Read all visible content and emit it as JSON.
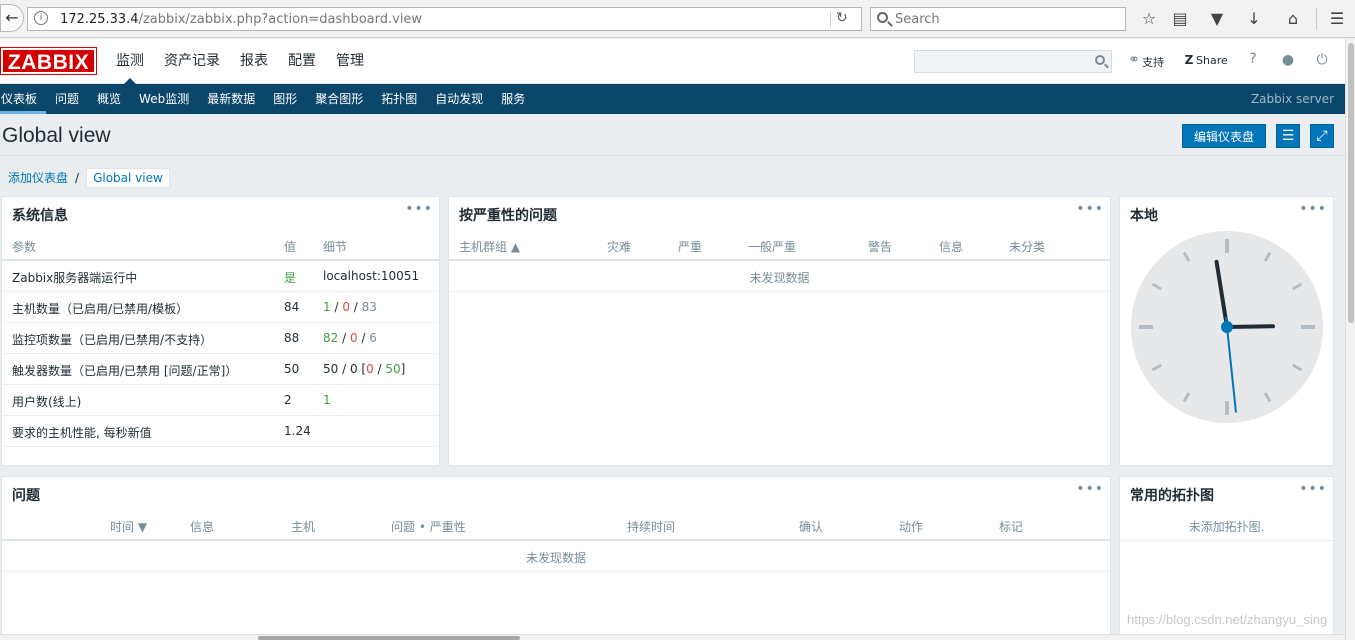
{
  "browser": {
    "url_host": "172.25.33.4",
    "url_path": "/zabbix/zabbix.php?action=dashboard.view",
    "search_placeholder": "Search"
  },
  "header": {
    "logo": "ZABBIX",
    "nav": [
      "监测",
      "资产记录",
      "报表",
      "配置",
      "管理"
    ],
    "support": "支持",
    "share": "Share",
    "help": "?"
  },
  "subnav": {
    "items": [
      "仪表板",
      "问题",
      "概览",
      "Web监测",
      "最新数据",
      "图形",
      "聚合图形",
      "拓扑图",
      "自动发现",
      "服务"
    ],
    "server": "Zabbix server"
  },
  "page": {
    "title": "Global view",
    "edit_button": "编辑仪表盘"
  },
  "breadcrumb": {
    "link": "添加仪表盘",
    "sep": "/",
    "current": "Global view"
  },
  "sysinfo": {
    "title": "系统信息",
    "headers": [
      "参数",
      "值",
      "细节"
    ],
    "rows": [
      {
        "param": "Zabbix服务器端运行中",
        "value": "是",
        "detail": "localhost:10051"
      },
      {
        "param": "主机数量（已启用/已禁用/模板）",
        "value": "84",
        "d1": "1",
        "d2": "0",
        "d3": "83"
      },
      {
        "param": "监控项数量（已启用/已禁用/不支持）",
        "value": "88",
        "d1": "82",
        "d2": "0",
        "d3": "6"
      },
      {
        "param": "触发器数量（已启用/已禁用 [问题/正常]）",
        "value": "50",
        "d_prefix": "50 / 0 [",
        "d1": "0",
        "d2": "50",
        "d_suffix": "]"
      },
      {
        "param": "用户数(线上)",
        "value": "2",
        "d1": "1"
      },
      {
        "param": "要求的主机性能, 每秒新值",
        "value": "1.24"
      }
    ]
  },
  "severity": {
    "title": "按严重性的问题",
    "headers": [
      "主机群组 ▲",
      "灾难",
      "严重",
      "一般严重",
      "警告",
      "信息",
      "未分类"
    ],
    "empty": "未发现数据"
  },
  "clock": {
    "title": "本地",
    "hour": 2,
    "minute": 58,
    "second": 29
  },
  "problems": {
    "title": "问题",
    "headers": [
      "时间 ▼",
      "信息",
      "主机",
      "问题 • 严重性",
      "持续时间",
      "确认",
      "动作",
      "标记"
    ],
    "empty": "未发现数据"
  },
  "maps": {
    "title": "常用的拓扑图",
    "empty": "未添加拓扑图."
  },
  "watermark": "https://blog.csdn.net/zhangyu_sing",
  "colors": {
    "brand": "#d40000",
    "nav": "#0a466a",
    "accent": "#0275b8"
  }
}
